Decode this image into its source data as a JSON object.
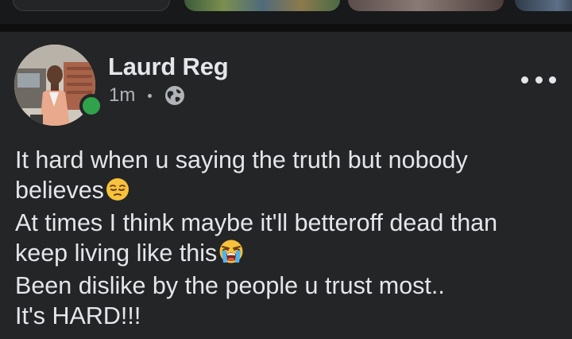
{
  "stories": [
    {
      "name": "create-story"
    },
    {
      "name": "story-1"
    },
    {
      "name": "story-2"
    },
    {
      "name": "story-3"
    }
  ],
  "post": {
    "author": "Laurd Reg",
    "time": "1m",
    "privacy_icon": "globe-icon",
    "more_icon": "more-options-icon",
    "online": true,
    "lines": [
      {
        "text": "It hard when u saying the truth but nobody",
        "emoji": ""
      },
      {
        "text": "believes",
        "emoji": "pensive-face"
      },
      {
        "text": "At times I think maybe it'll betteroff dead than",
        "emoji": ""
      },
      {
        "text": "keep living like this",
        "emoji": "loudly-crying-face"
      },
      {
        "text": "Been dislike by the people u trust most..",
        "emoji": ""
      },
      {
        "text": "It's HARD!!!",
        "emoji": ""
      }
    ]
  },
  "colors": {
    "background": "#18191a",
    "card": "#242526",
    "text_primary": "#e4e6eb",
    "text_secondary": "#b0b3b8",
    "online_green": "#31a24c"
  }
}
